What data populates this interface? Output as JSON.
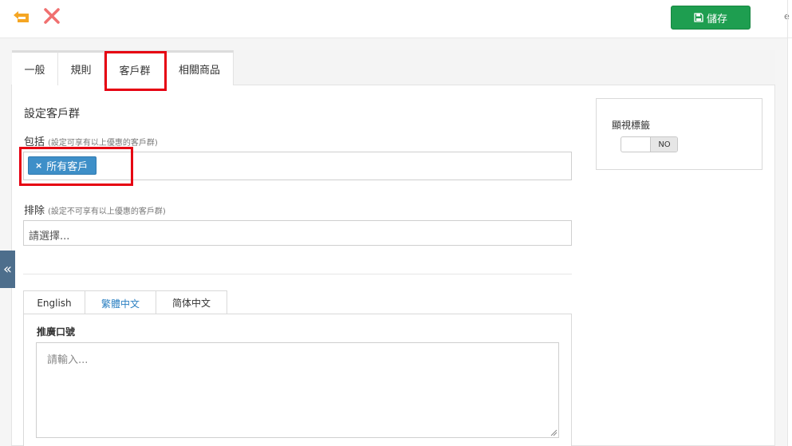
{
  "toolbar": {
    "save_label": "儲存",
    "edge_char": "e"
  },
  "tabs": [
    {
      "label": "一般"
    },
    {
      "label": "規則"
    },
    {
      "label": "客戶群"
    },
    {
      "label": "相關商品"
    }
  ],
  "section": {
    "title": "設定客戶群",
    "include_label": "包括",
    "include_hint": "(設定可享有以上優惠的客戶群)",
    "include_tag": "所有客戶",
    "include_tag_remove": "×",
    "exclude_label": "排除",
    "exclude_hint": "(設定不可享有以上優惠的客戶群)",
    "exclude_placeholder": "請選擇..."
  },
  "side": {
    "label": "顯視標籤",
    "toggle_value": "NO"
  },
  "collapse_glyph": "«",
  "lang_tabs": [
    {
      "label": "English"
    },
    {
      "label": "繁體中文"
    },
    {
      "label": "简体中文"
    }
  ],
  "slogan": {
    "label": "推廣口號",
    "placeholder": "請輸入..."
  },
  "colors": {
    "save_green": "#1e9e50",
    "tag_blue": "#3e8fc8",
    "highlight_red": "#e60012",
    "undo_orange": "#f5a623",
    "close_red": "#f07070",
    "collapse_bg": "#4d6e8c",
    "active_lang": "#2a7fc1"
  }
}
